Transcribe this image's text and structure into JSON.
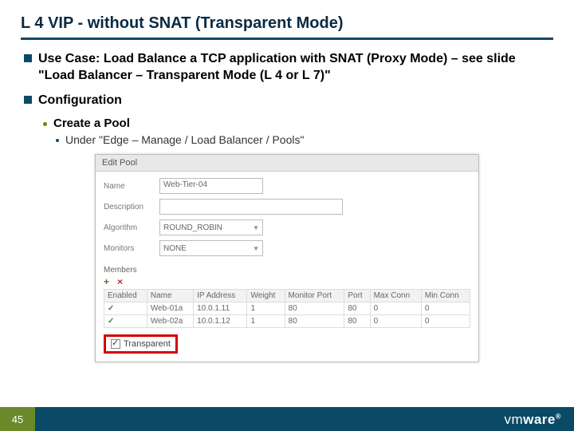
{
  "title": "L 4 VIP - without SNAT (Transparent Mode)",
  "bullets": {
    "use_case": "Use Case: Load Balance a TCP application with SNAT (Proxy Mode) – see slide \"Load Balancer – Transparent Mode (L 4 or L 7)\"",
    "config": "Configuration",
    "create_pool": "Create a Pool",
    "under": "Under \"Edge – Manage / Load Balancer / Pools\""
  },
  "dialog": {
    "title": "Edit Pool",
    "labels": {
      "name": "Name",
      "description": "Description",
      "algorithm": "Algorithm",
      "monitors": "Monitors",
      "members": "Members"
    },
    "values": {
      "name": "Web-Tier-04",
      "description": "",
      "algorithm": "ROUND_ROBIN",
      "monitors": "NONE"
    },
    "toolbar_add": "+",
    "toolbar_del": "×",
    "columns": [
      "Enabled",
      "Name",
      "IP Address",
      "Weight",
      "Monitor Port",
      "Port",
      "Max Conn",
      "Min Conn"
    ],
    "row1": {
      "enabled": "✓",
      "name": "Web-01a",
      "ip": "10.0.1.11",
      "weight": "1",
      "mport": "80",
      "port": "80",
      "max": "0",
      "min": "0"
    },
    "row2": {
      "enabled": "✓",
      "name": "Web-02a",
      "ip": "10.0.1.12",
      "weight": "1",
      "mport": "80",
      "port": "80",
      "max": "0",
      "min": "0"
    },
    "transparent": "Transparent"
  },
  "footer": {
    "page": "45",
    "brand_prefix": "vm",
    "brand_suffix": "ware",
    "reg": "®"
  }
}
